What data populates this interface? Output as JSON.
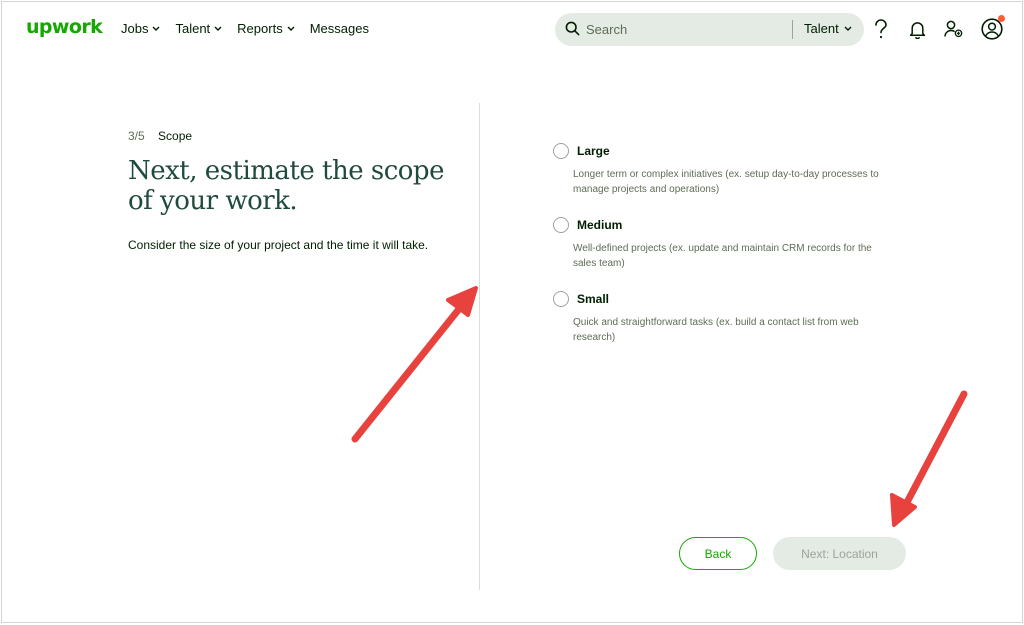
{
  "app": {
    "logo_text": "upwork",
    "brand_color": "#14a800"
  },
  "nav": {
    "items": [
      {
        "label": "Jobs",
        "has_dropdown": true
      },
      {
        "label": "Talent",
        "has_dropdown": true
      },
      {
        "label": "Reports",
        "has_dropdown": true
      },
      {
        "label": "Messages",
        "has_dropdown": false
      }
    ]
  },
  "search": {
    "placeholder": "Search",
    "scope": "Talent"
  },
  "header_icons": [
    "help-icon",
    "bell-icon",
    "invite-user-icon",
    "profile-avatar-icon"
  ],
  "step": {
    "count": "3/5",
    "name": "Scope"
  },
  "page": {
    "title": "Next, estimate the scope of your work.",
    "subtitle": "Consider the size of your project and the time it will take."
  },
  "options": [
    {
      "label": "Large",
      "description": "Longer term or complex initiatives (ex. setup day-to-day processes to manage projects and operations)",
      "selected": false
    },
    {
      "label": "Medium",
      "description": "Well-defined projects (ex. update and maintain CRM records for the sales team)",
      "selected": false
    },
    {
      "label": "Small",
      "description": "Quick and straightforward tasks (ex. build a contact list from web research)",
      "selected": false
    }
  ],
  "buttons": {
    "back": "Back",
    "next": "Next: Location"
  },
  "annotation_color": "#e8423f"
}
